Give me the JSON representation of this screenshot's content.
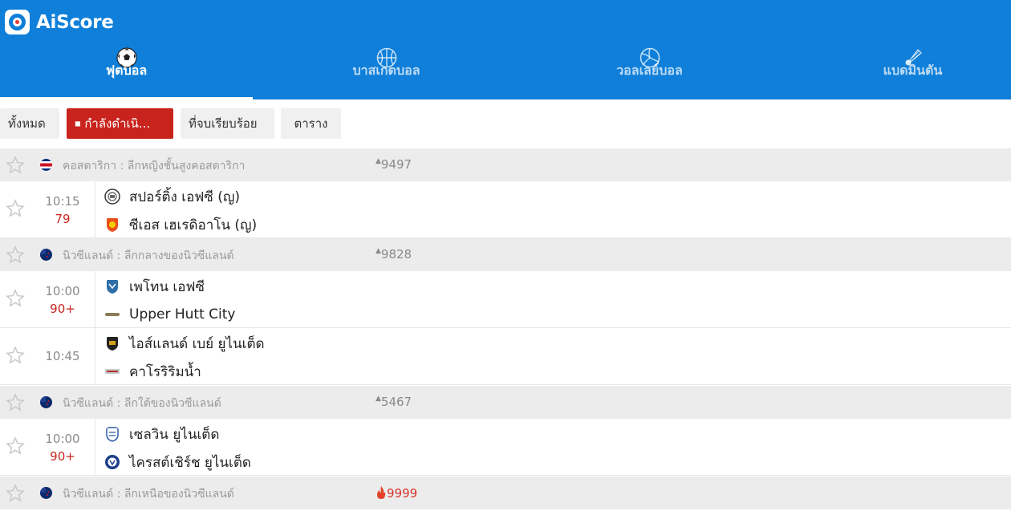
{
  "app": {
    "title": "AiScore"
  },
  "sports_tabs": [
    {
      "label": "ฟุตบอล",
      "icon": "football-icon",
      "active": true
    },
    {
      "label": "บาสเกตบอล",
      "icon": "basketball-icon",
      "active": false
    },
    {
      "label": "วอลเลย์บอล",
      "icon": "volleyball-icon",
      "active": false
    },
    {
      "label": "แบดมินตัน",
      "icon": "shuttlecock-icon",
      "active": false
    }
  ],
  "filters": [
    {
      "label": "ทั้งหมด",
      "active": false
    },
    {
      "label": "กำลังดำเนิ...",
      "active": true
    },
    {
      "label": "ที่จบเรียบร้อย",
      "active": false
    },
    {
      "label": "ตาราง",
      "active": false
    }
  ],
  "leagues": [
    {
      "name": "คอสตาริกา : ลีกหญิงชั้นสูงคอสตาริกา",
      "count": "9497",
      "flag": "costa-rica-flag",
      "matches": [
        {
          "time": "10:15",
          "minute": "79",
          "home": "สปอร์ติ้ง เอฟซี (ญ)",
          "away": "ซีเอส เฮเรดิอาโน (ญ)"
        }
      ]
    },
    {
      "name": "นิวซีแลนด์ : ลีกกลางของนิวซีแลนด์",
      "count": "9828",
      "flag": "new-zealand-flag",
      "matches": [
        {
          "time": "10:00",
          "minute": "90+",
          "home": "เพโทน เอฟซี",
          "away": "Upper Hutt City"
        },
        {
          "time": "10:45",
          "minute": "",
          "home": "ไอส์แลนด์ เบย์ ยูไนเต็ด",
          "away": "คาโรริริมน้ำ"
        }
      ]
    },
    {
      "name": "นิวซีแลนด์ : ลีกใต้ของนิวซีแลนด์",
      "count": "5467",
      "flag": "new-zealand-flag",
      "matches": [
        {
          "time": "10:00",
          "minute": "90+",
          "home": "เซลวิน ยูไนเต็ด",
          "away": "ไครสต์เชิร์ช ยูไนเต็ด"
        }
      ]
    },
    {
      "name": "นิวซีแลนด์ : ลีกเหนือของนิวซีแลนด์",
      "count": "9999",
      "flag": "new-zealand-flag",
      "hot": true,
      "matches": []
    }
  ],
  "colors": {
    "brand": "#0f7fd9",
    "live": "#c9231d",
    "league_bg": "#ececec"
  }
}
